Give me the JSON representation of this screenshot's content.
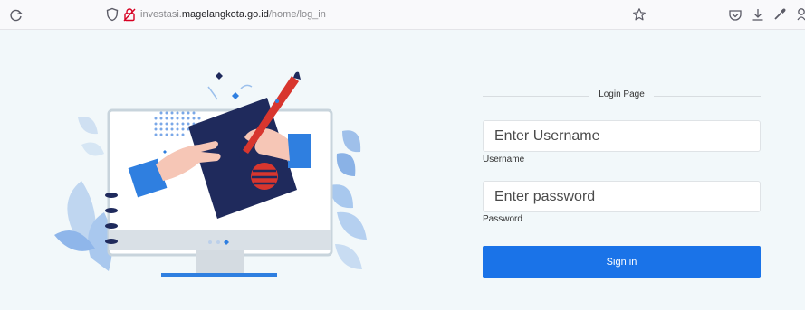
{
  "browser": {
    "url_prefix": "investasi.",
    "url_host": "magelangkota.go.id",
    "url_path": "/home/log_in"
  },
  "login": {
    "title": "Login Page",
    "username_placeholder": "Enter Username",
    "username_label": "Username",
    "password_placeholder": "Enter password",
    "password_label": "Password",
    "signin_label": "Sign in"
  },
  "colors": {
    "page_background": "#f2f8fa",
    "primary_button": "#1a73e8",
    "illustration_navy": "#1f2a5c",
    "illustration_blue": "#2f7fe0",
    "illustration_red": "#d8362e"
  },
  "icons": [
    "reload-icon",
    "shield-icon",
    "lock-icon",
    "star-icon",
    "pocket-icon",
    "download-icon",
    "eyedropper-icon",
    "more-icon"
  ]
}
